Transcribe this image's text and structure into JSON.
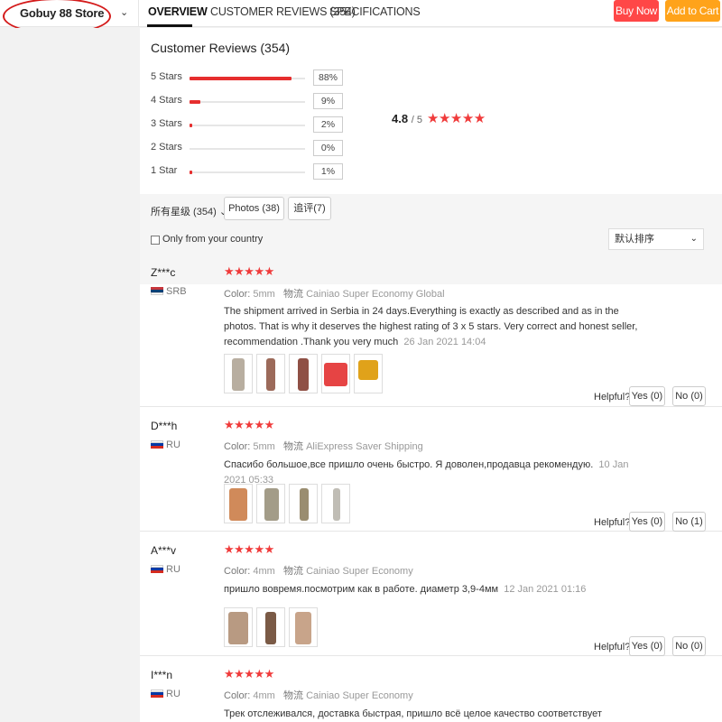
{
  "header": {
    "store_name": "Gobuy 88 Store",
    "tabs": [
      {
        "label": "OVERVIEW",
        "active": true
      },
      {
        "label": "CUSTOMER REVIEWS (354)",
        "active": false
      },
      {
        "label": "SPECIFICATIONS",
        "active": false
      }
    ],
    "buy_now": "Buy Now",
    "add_to_cart": "Add to Cart",
    "colors": {
      "buy_now": "#ff4747",
      "add_to_cart": "#ffa31a"
    }
  },
  "summary": {
    "title": "Customer Reviews (354)",
    "rows": [
      {
        "label": "5 Stars",
        "percent": 88,
        "percent_text": "88%"
      },
      {
        "label": "4 Stars",
        "percent": 9,
        "percent_text": "9%"
      },
      {
        "label": "3 Stars",
        "percent": 2,
        "percent_text": "2%"
      },
      {
        "label": "2 Stars",
        "percent": 0,
        "percent_text": "0%"
      },
      {
        "label": "1 Star",
        "percent": 1,
        "percent_text": "1%"
      }
    ],
    "average": "4.8",
    "average_out_of": "/ 5",
    "average_stars": "★★★★★"
  },
  "filters": {
    "all_ratings": "所有星级 (354)",
    "photos": "Photos (38)",
    "additional": "追评(7)",
    "only_country": "Only from your country",
    "sort": "默认排序"
  },
  "reviews": [
    {
      "name": "Z***c",
      "country": "SRB",
      "stars": "★★★★★",
      "color_label": "Color:",
      "color_value": "5mm",
      "logistics_label": "物流",
      "logistics": "Cainiao Super Economy Global",
      "text": "The shipment arrived in Serbia in 24 days.Everything is exactly as described and as in the photos. That is why it deserves the highest rating of 3 x 5 stars. Very correct and honest seller, recommendation .Thank you very much",
      "date": "26 Jan 2021 14:04",
      "helpful": "Helpful?",
      "yes": "Yes (0)",
      "no": "No (0)"
    },
    {
      "name": "D***h",
      "country": "RU",
      "stars": "★★★★★",
      "color_label": "Color:",
      "color_value": "5mm",
      "logistics_label": "物流",
      "logistics": "AliExpress Saver Shipping",
      "text": "Спасибо большое,все пришло очень быстро. Я доволен,продавца рекомендую.",
      "date": "10 Jan 2021 05:33",
      "helpful": "Helpful?",
      "yes": "Yes (0)",
      "no": "No (1)"
    },
    {
      "name": "A***v",
      "country": "RU",
      "stars": "★★★★★",
      "color_label": "Color:",
      "color_value": "4mm",
      "logistics_label": "物流",
      "logistics": "Cainiao Super Economy",
      "text": "пришло вовремя.посмотрим как в работе. диаметр 3,9-4мм",
      "date": "12 Jan 2021 01:16",
      "helpful": "Helpful?",
      "yes": "Yes (0)",
      "no": "No (0)"
    },
    {
      "name": "I***n",
      "country": "RU",
      "stars": "★★★★★",
      "color_label": "Color:",
      "color_value": "4mm",
      "logistics_label": "物流",
      "logistics": "Cainiao Super Economy",
      "text": "Трек отслеживался, доставка быстрая, пришло всё целое качество соответствует описанию продавца"
    }
  ]
}
